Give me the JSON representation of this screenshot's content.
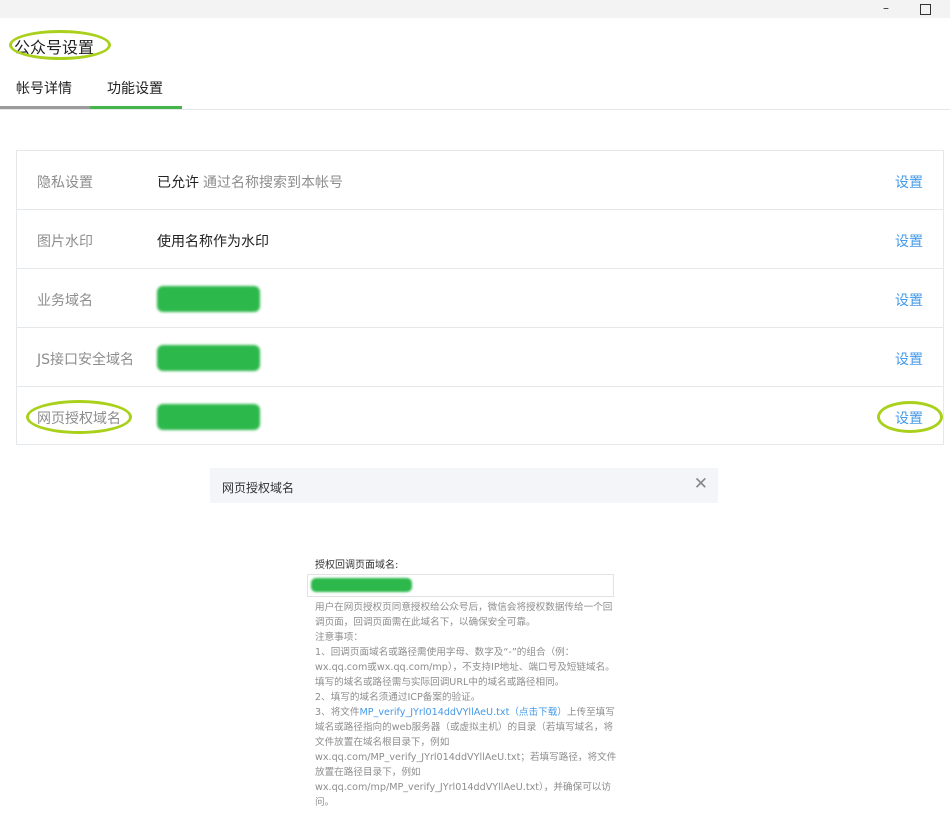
{
  "window": {
    "minimize_glyph": "–",
    "maximize_glyph": ""
  },
  "page": {
    "title": "公众号设置"
  },
  "tabs": [
    {
      "label": "帐号详情",
      "active": false
    },
    {
      "label": "功能设置",
      "active": true
    }
  ],
  "settings": {
    "rows": [
      {
        "label": "隐私设置",
        "value": "已允许",
        "desc": "通过名称搜索到本帐号",
        "action": "设置"
      },
      {
        "label": "图片水印",
        "value": "使用名称作为水印",
        "desc": "",
        "action": "设置"
      },
      {
        "label": "业务域名",
        "value": "",
        "desc": "",
        "action": "设置"
      },
      {
        "label": "JS接口安全域名",
        "value": "",
        "desc": "",
        "action": "设置"
      },
      {
        "label": "网页授权域名",
        "value": "",
        "desc": "",
        "action": "设置"
      }
    ]
  },
  "dialog": {
    "title": "网页授权域名",
    "field_label": "授权回调页面域名:",
    "desc_1": "用户在网页授权页同意授权给公众号后，微信会将授权数据传给一个回调页面，回调页面需在此域名下，以确保安全可靠。",
    "notes_title": "注意事项：",
    "note_1": "1、回调页面域名或路径需使用字母、数字及“-”的组合（例：wx.qq.com或wx.qq.com/mp），不支持IP地址、端口号及短链域名。填写的域名或路径需与实际回调URL中的域名或路径相同。",
    "note_2": "2、填写的域名须通过ICP备案的验证。",
    "note_3_prefix": "3、将文件",
    "note_3_file": "MP_verify_JYrl014ddVYllAeU.txt",
    "note_3_download": "（点击下载）",
    "note_3_suffix": "上传至填写域名或路径指向的web服务器（或虚拟主机）的目录（若填写域名，将文件放置在域名根目录下，例如wx.qq.com/MP_verify_JYrl014ddVYllAeU.txt；若填写路径，将文件放置在路径目录下，例如wx.qq.com/mp/MP_verify_JYrl014ddVYllAeU.txt），并确保可以访问。"
  },
  "colors": {
    "accent": "#44b549",
    "link": "#459ae9",
    "highlight": "#a9d11c"
  }
}
